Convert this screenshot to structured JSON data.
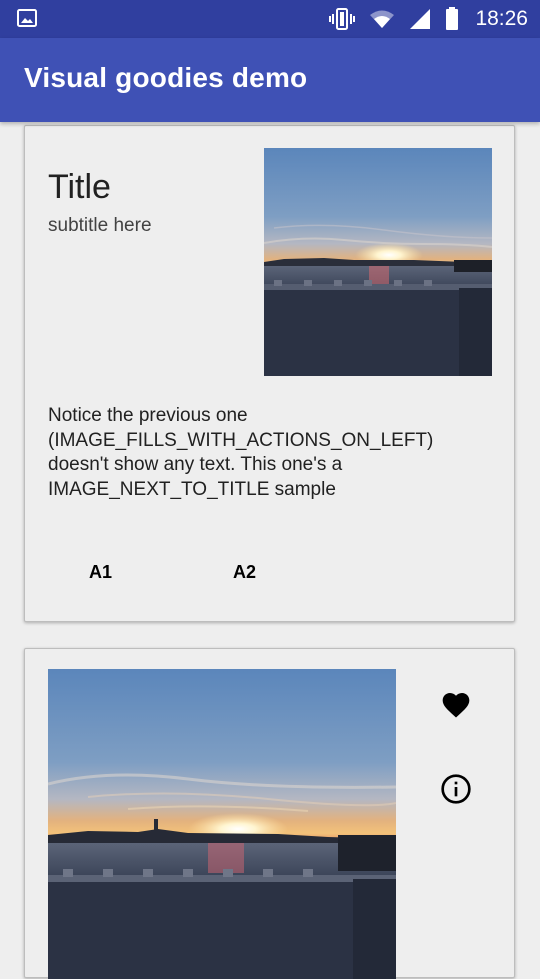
{
  "status_bar": {
    "time": "18:26",
    "icons": [
      "image-icon",
      "vibrate-icon",
      "wifi-icon",
      "signal-icon",
      "battery-icon"
    ]
  },
  "app_bar": {
    "title": "Visual goodies demo"
  },
  "card1": {
    "title": "Title",
    "subtitle": "subtitle here",
    "body": "Notice the previous one (IMAGE_FILLS_WITH_ACTIONS_ON_LEFT) doesn't show any text. This one's a IMAGE_NEXT_TO_TITLE sample",
    "actions": [
      "A1",
      "A2"
    ]
  },
  "card2": {
    "actions": [
      "heart-icon",
      "info-icon"
    ]
  },
  "colors": {
    "status_bar": "#303f9f",
    "app_bar": "#3f51b5",
    "background": "#eeeeee"
  }
}
